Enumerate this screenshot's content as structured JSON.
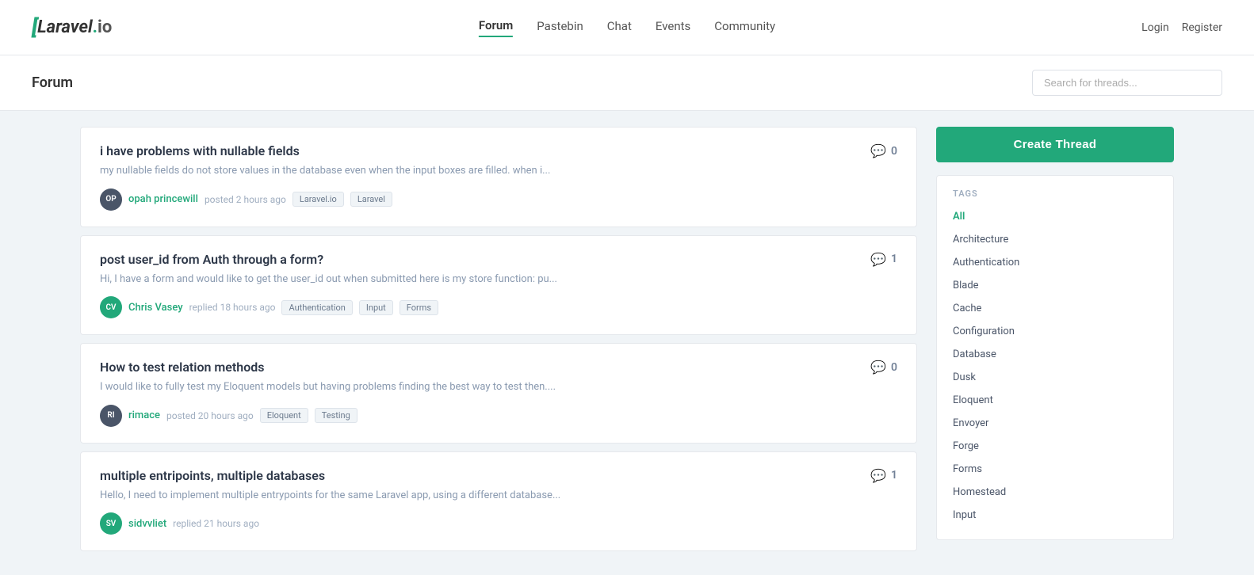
{
  "header": {
    "logo_bracket": "[",
    "logo_text": "Laravel",
    "logo_dot": ".",
    "logo_io": "io",
    "nav": [
      {
        "label": "Forum",
        "href": "#",
        "active": true
      },
      {
        "label": "Pastebin",
        "href": "#",
        "active": false
      },
      {
        "label": "Chat",
        "href": "#",
        "active": false
      },
      {
        "label": "Events",
        "href": "#",
        "active": false
      },
      {
        "label": "Community",
        "href": "#",
        "active": false
      }
    ],
    "login_label": "Login",
    "register_label": "Register"
  },
  "subheader": {
    "title": "Forum",
    "search_placeholder": "Search for threads..."
  },
  "threads": [
    {
      "id": 1,
      "title": "i have problems with nullable fields",
      "excerpt": "my nullable fields do not store values in the database even when the input boxes are filled. when i...",
      "avatar_initials": "OP",
      "avatar_color": "dark",
      "username": "opah princewill",
      "action": "posted",
      "time": "2 hours ago",
      "tags": [
        "Laravel.io",
        "Laravel"
      ],
      "comment_count": 0
    },
    {
      "id": 2,
      "title": "post user_id from Auth through a form?",
      "excerpt": "Hi, I have a form and would like to get the user_id out when submitted here is my store function: pu...",
      "avatar_initials": "CV",
      "avatar_color": "green",
      "username": "Chris Vasey",
      "action": "replied",
      "time": "18 hours ago",
      "tags": [
        "Authentication",
        "Input",
        "Forms"
      ],
      "comment_count": 1
    },
    {
      "id": 3,
      "title": "How to test relation methods",
      "excerpt": "I would like to fully test my Eloquent models but having problems finding the best way to test then....",
      "avatar_initials": "RI",
      "avatar_color": "dark",
      "username": "rimace",
      "action": "posted",
      "time": "20 hours ago",
      "tags": [
        "Eloquent",
        "Testing"
      ],
      "comment_count": 0
    },
    {
      "id": 4,
      "title": "multiple entripoints, multiple databases",
      "excerpt": "Hello, I need to implement multiple entrypoints for the same Laravel app, using a different database...",
      "avatar_initials": "SV",
      "avatar_color": "green",
      "username": "sidvvliet",
      "action": "replied",
      "time": "21 hours ago",
      "tags": [],
      "comment_count": 1
    }
  ],
  "sidebar": {
    "create_thread_label": "Create Thread",
    "tags_heading": "TAGS",
    "tags": [
      {
        "label": "All",
        "active": true
      },
      {
        "label": "Architecture",
        "active": false
      },
      {
        "label": "Authentication",
        "active": false
      },
      {
        "label": "Blade",
        "active": false
      },
      {
        "label": "Cache",
        "active": false
      },
      {
        "label": "Configuration",
        "active": false
      },
      {
        "label": "Database",
        "active": false
      },
      {
        "label": "Dusk",
        "active": false
      },
      {
        "label": "Eloquent",
        "active": false
      },
      {
        "label": "Envoyer",
        "active": false
      },
      {
        "label": "Forge",
        "active": false
      },
      {
        "label": "Forms",
        "active": false
      },
      {
        "label": "Homestead",
        "active": false
      },
      {
        "label": "Input",
        "active": false
      }
    ]
  },
  "colors": {
    "accent": "#22a87a"
  }
}
